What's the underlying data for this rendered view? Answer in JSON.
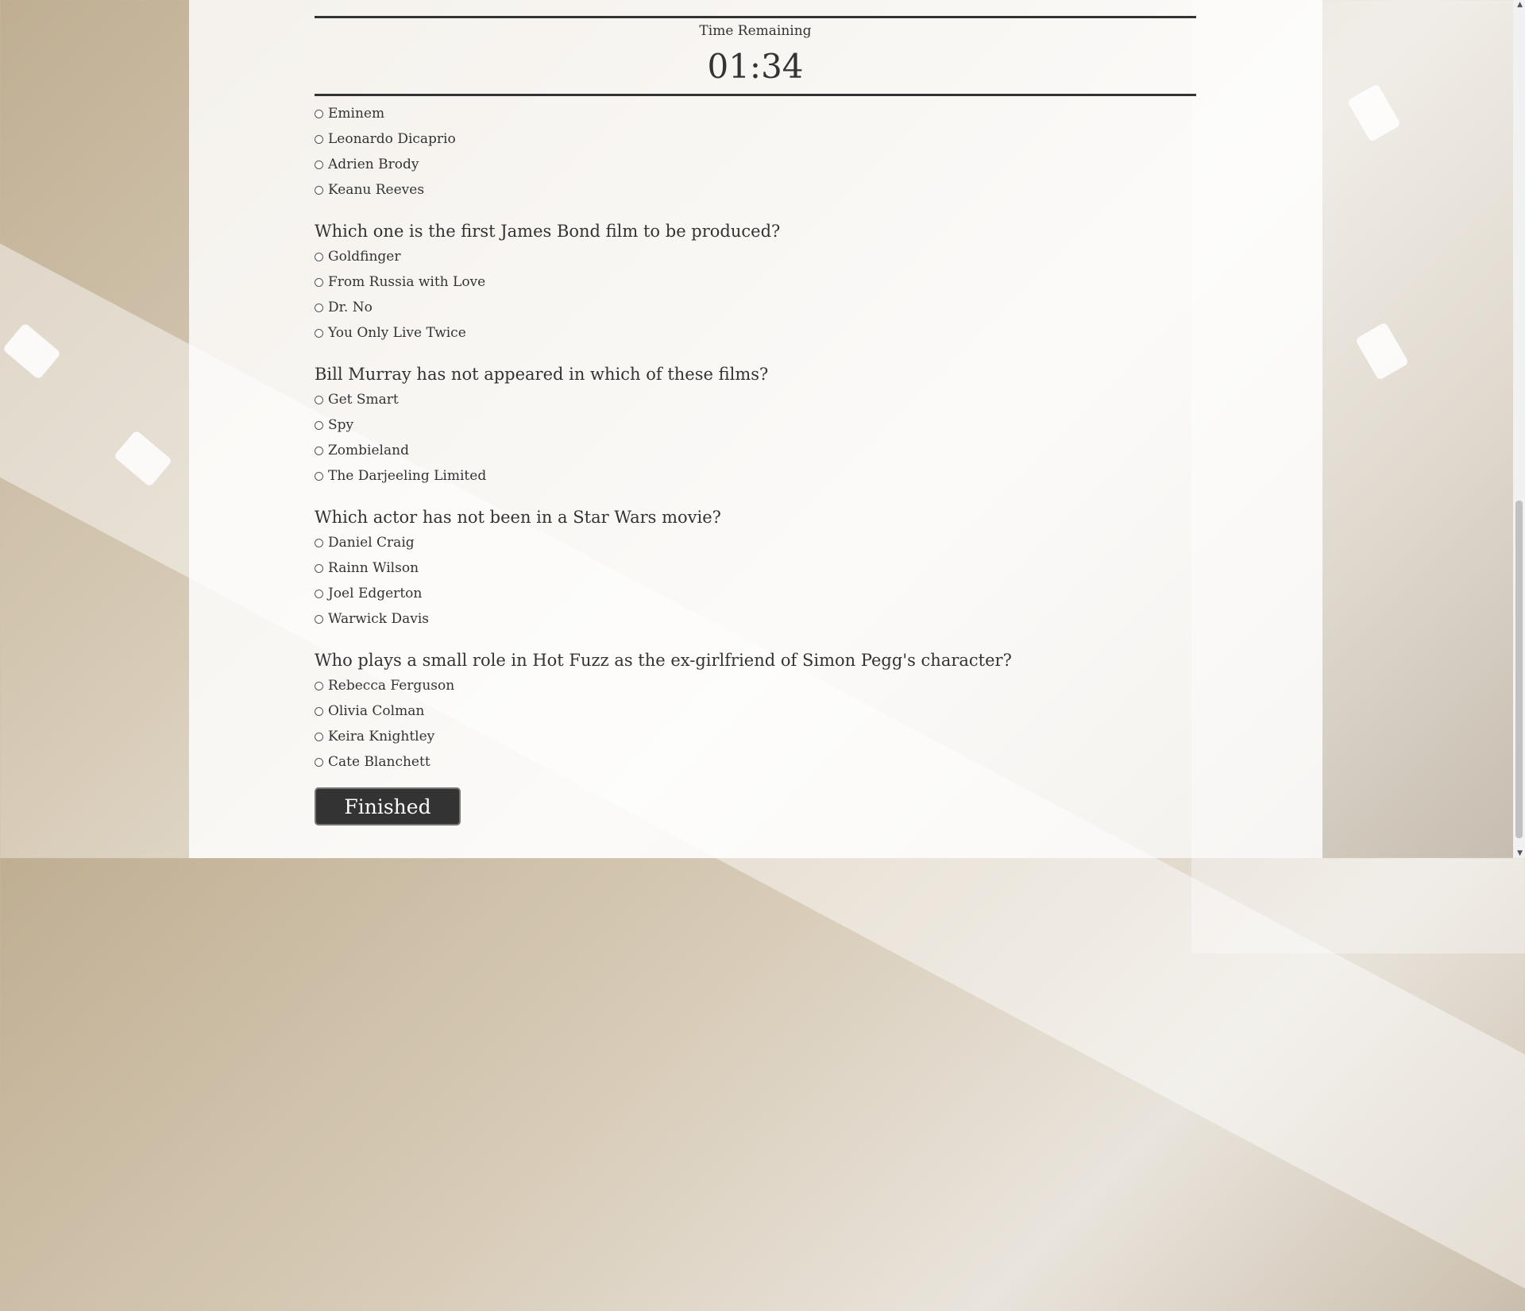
{
  "timer": {
    "label": "Time Remaining",
    "value": "01:34"
  },
  "first_options": [
    "Eminem",
    "Leonardo Dicaprio",
    "Adrien Brody",
    "Keanu Reeves"
  ],
  "questions": [
    {
      "text": "Which one is the first James Bond film to be produced?",
      "options": [
        "Goldfinger",
        "From Russia with Love",
        "Dr. No",
        "You Only Live Twice"
      ]
    },
    {
      "text": "Bill Murray has not appeared in which of these films?",
      "options": [
        "Get Smart",
        "Spy",
        "Zombieland",
        "The Darjeeling Limited"
      ]
    },
    {
      "text": "Which actor has not been in a Star Wars movie?",
      "options": [
        "Daniel Craig",
        "Rainn Wilson",
        "Joel Edgerton",
        "Warwick Davis"
      ]
    },
    {
      "text": "Who plays a small role in Hot Fuzz as the ex-girlfriend of Simon Pegg's character?",
      "options": [
        "Rebecca Ferguson",
        "Olivia Colman",
        "Keira Knightley",
        "Cate Blanchett"
      ]
    }
  ],
  "finish_label": "Finished",
  "scroll": {
    "up_arrow": "▲",
    "down_arrow": "▼"
  }
}
